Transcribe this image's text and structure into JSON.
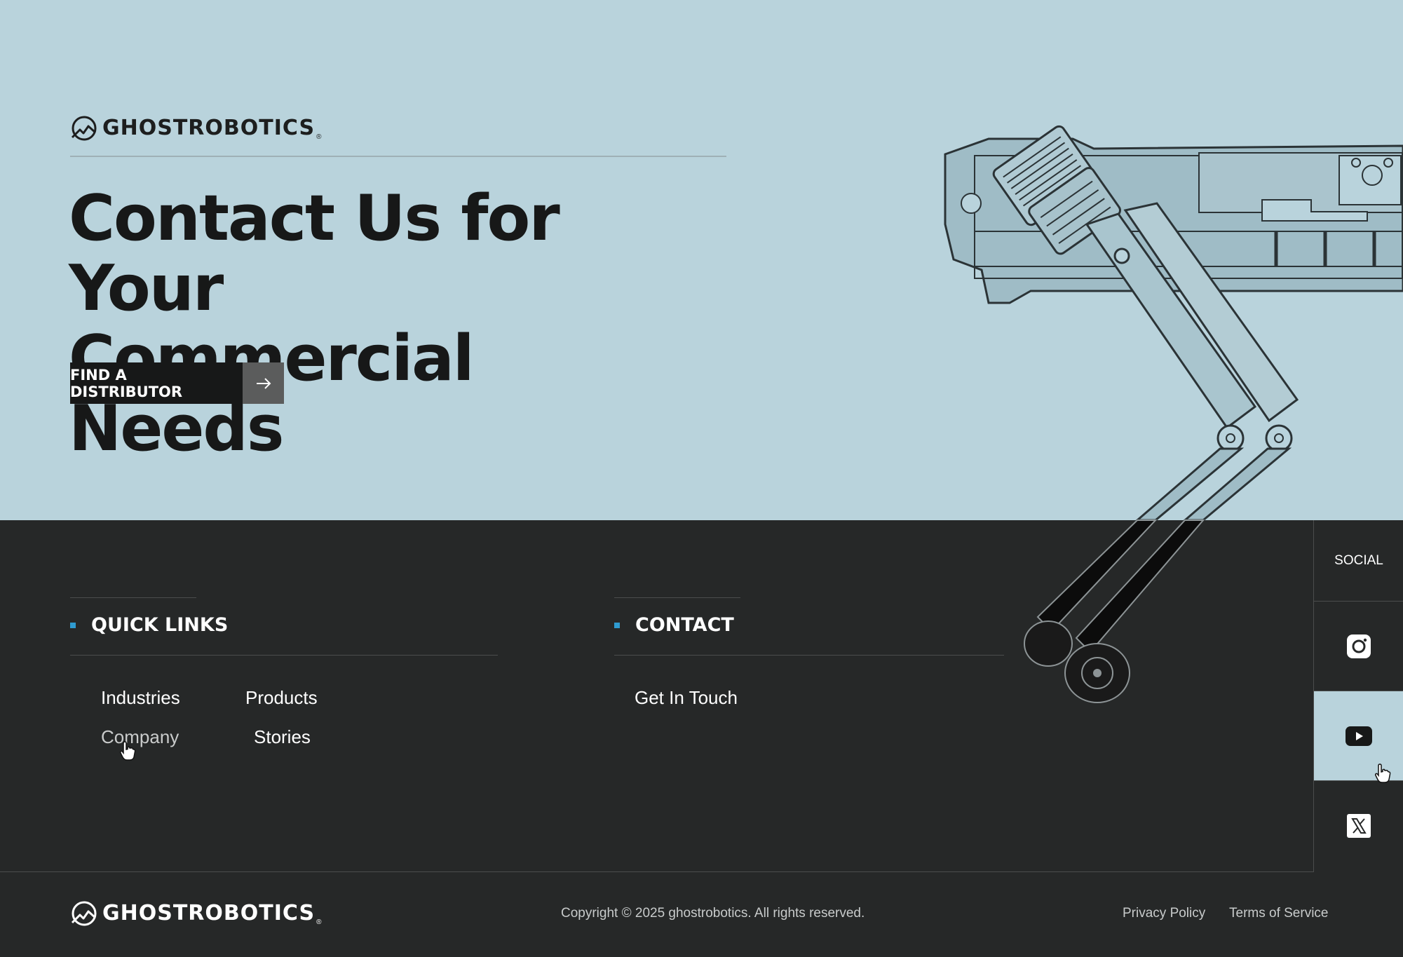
{
  "brand": {
    "name": "GHOSTROBOTICS",
    "registered": "®"
  },
  "hero": {
    "title_line1": "Contact Us for Your",
    "title_line2": "Commercial Needs",
    "cta_label": "FIND A DISTRIBUTOR",
    "cta_icon": "arrow-right-icon"
  },
  "quick_links": {
    "title": "QUICK LINKS",
    "items": [
      "Industries",
      "Products",
      "Company",
      "Stories"
    ]
  },
  "contact": {
    "title": "CONTACT",
    "items": [
      "Get In Touch"
    ]
  },
  "social": {
    "title": "SOCIAL",
    "items": [
      "instagram-icon",
      "youtube-icon",
      "x-icon"
    ]
  },
  "footer": {
    "copyright": "Copyright © 2025 ghostrobotics. All rights reserved.",
    "privacy": "Privacy Policy",
    "terms": "Terms of Service"
  },
  "colors": {
    "hero_bg": "#b9d3dc",
    "footer_bg": "#262828",
    "accent": "#2f9bd0"
  }
}
